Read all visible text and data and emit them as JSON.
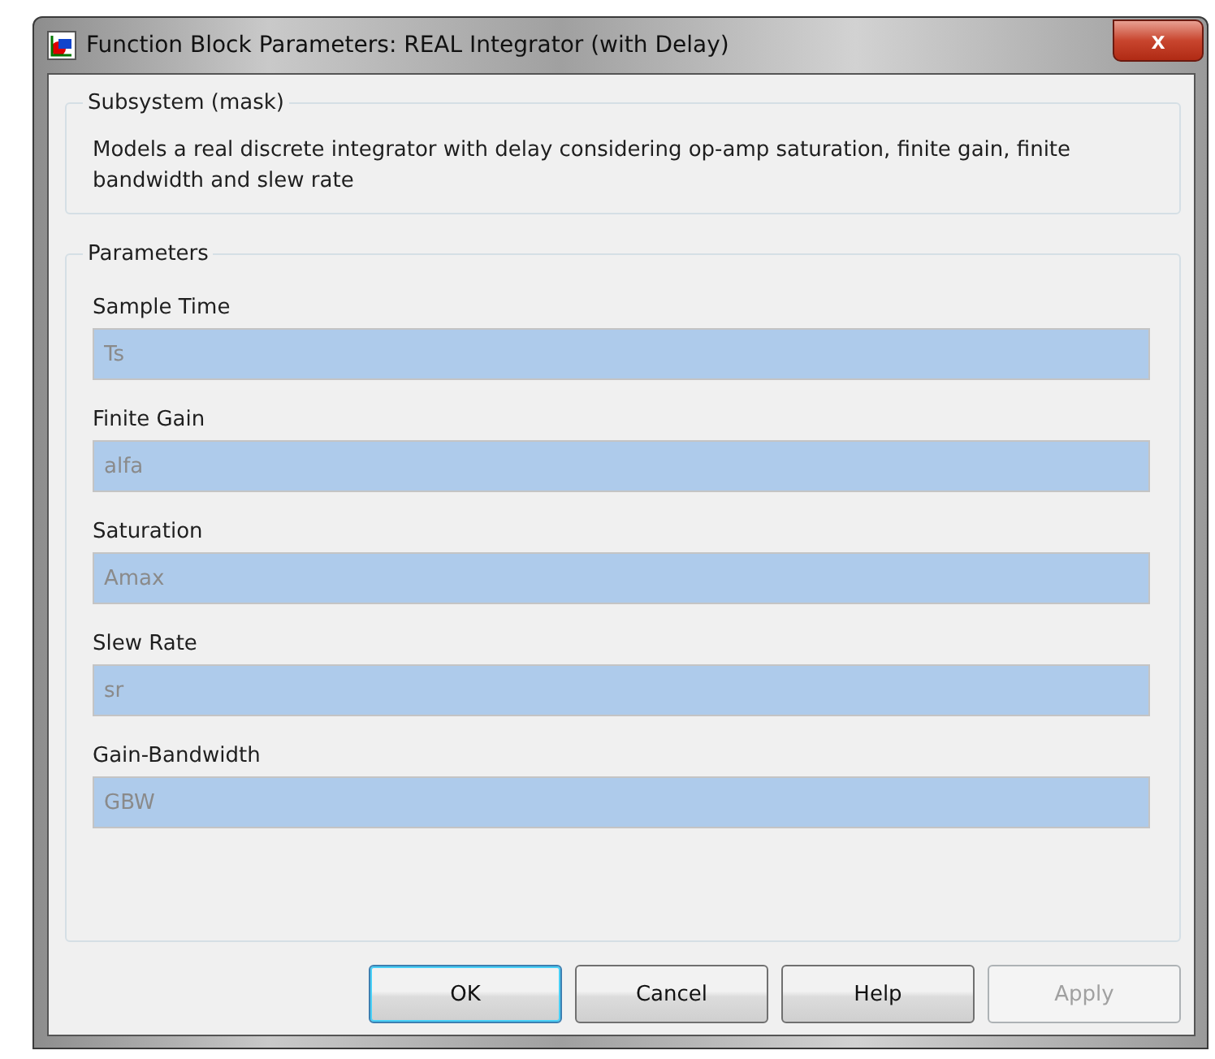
{
  "window": {
    "title": "Function Block Parameters: REAL Integrator (with Delay)",
    "close": "x"
  },
  "description": {
    "legend": "Subsystem (mask)",
    "text": "Models a real discrete integrator with delay considering op-amp saturation, finite gain, finite bandwidth and slew rate"
  },
  "parameters": {
    "legend": "Parameters",
    "fields": [
      {
        "label": "Sample Time",
        "value": "Ts",
        "disabled": true
      },
      {
        "label": "Finite Gain",
        "value": "alfa",
        "disabled": true
      },
      {
        "label": "Saturation",
        "value": "Amax",
        "disabled": true
      },
      {
        "label": "Slew Rate",
        "value": "sr",
        "disabled": true
      },
      {
        "label": "Gain-Bandwidth",
        "value": "GBW",
        "disabled": true
      }
    ]
  },
  "buttons": [
    {
      "label": "OK",
      "default": true,
      "disabled": false
    },
    {
      "label": "Cancel",
      "default": false,
      "disabled": false
    },
    {
      "label": "Help",
      "default": false,
      "disabled": false
    },
    {
      "label": "Apply",
      "default": false,
      "disabled": true
    }
  ]
}
